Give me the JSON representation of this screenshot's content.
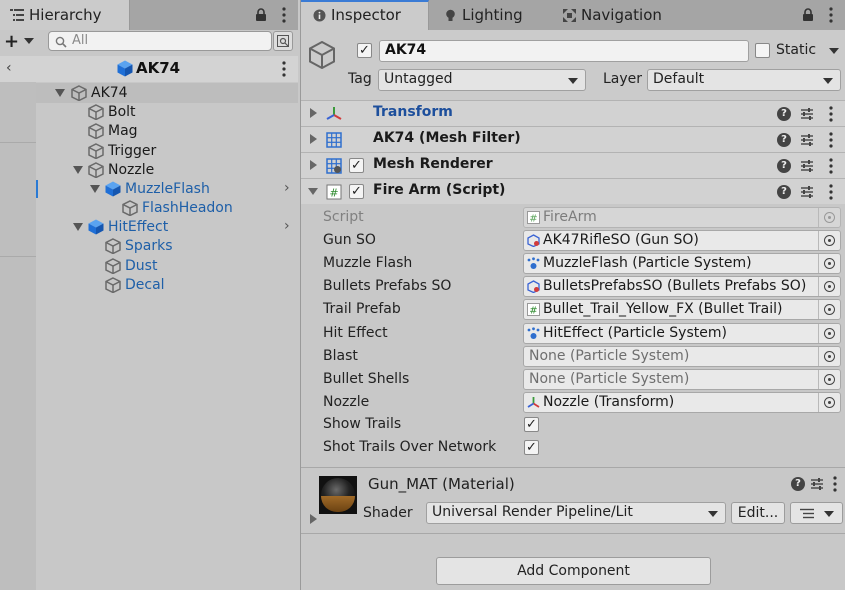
{
  "hierarchy": {
    "tab_title": "Hierarchy",
    "search_placeholder": "All",
    "scene_title": "AK74",
    "tree": [
      {
        "label": "AK74"
      },
      {
        "label": "Bolt"
      },
      {
        "label": "Mag"
      },
      {
        "label": "Trigger"
      },
      {
        "label": "Nozzle"
      },
      {
        "label": "MuzzleFlash"
      },
      {
        "label": "FlashHeadon"
      },
      {
        "label": "HitEffect"
      },
      {
        "label": "Sparks"
      },
      {
        "label": "Dust"
      },
      {
        "label": "Decal"
      }
    ]
  },
  "inspector": {
    "tabs": [
      {
        "label": "Inspector"
      },
      {
        "label": "Lighting"
      },
      {
        "label": "Navigation"
      }
    ],
    "object_name": "AK74",
    "static_label": "Static",
    "tag_label": "Tag",
    "tag_value": "Untagged",
    "layer_label": "Layer",
    "layer_value": "Default",
    "components": [
      {
        "title": "Transform"
      },
      {
        "title": "AK74 (Mesh Filter)"
      },
      {
        "title": "Mesh Renderer"
      },
      {
        "title": "Fire Arm (Script)"
      }
    ],
    "fields": [
      {
        "label": "Script",
        "value": "FireArm"
      },
      {
        "label": "Gun SO",
        "value": "AK47RifleSO (Gun SO)"
      },
      {
        "label": "Muzzle Flash",
        "value": "MuzzleFlash (Particle System)"
      },
      {
        "label": "Bullets Prefabs SO",
        "value": "BulletsPrefabsSO (Bullets Prefabs SO)"
      },
      {
        "label": "Trail Prefab",
        "value": "Bullet_Trail_Yellow_FX (Bullet Trail)"
      },
      {
        "label": "Hit Effect",
        "value": "HitEffect (Particle System)"
      },
      {
        "label": "Blast",
        "value": "None (Particle System)"
      },
      {
        "label": "Bullet Shells",
        "value": "None (Particle System)"
      },
      {
        "label": "Nozzle",
        "value": "Nozzle (Transform)"
      },
      {
        "label": "Show Trails"
      },
      {
        "label": "Shot Trails Over Network"
      }
    ],
    "material": {
      "title": "Gun_MAT (Material)",
      "shader_label": "Shader",
      "shader_value": "Universal Render Pipeline/Lit",
      "edit_label": "Edit..."
    },
    "add_component_label": "Add Component"
  },
  "colors": {
    "panel_bg": "#c8c8c8",
    "prefab_blue": "#1e5fa8",
    "accent": "#3a7bd5"
  }
}
